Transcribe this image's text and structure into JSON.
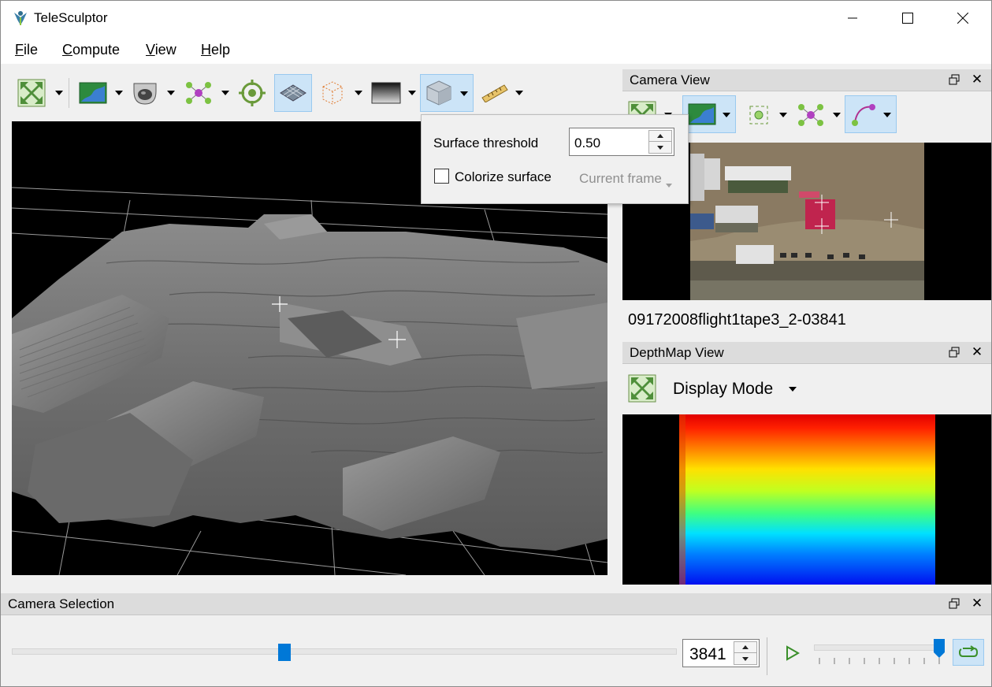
{
  "window": {
    "title": "TeleSculptor",
    "controls": {
      "minimize": "–",
      "maximize": "☐",
      "close": "✕"
    }
  },
  "menu": {
    "items": [
      "File",
      "Compute",
      "View",
      "Help"
    ]
  },
  "main_toolbar": {
    "buttons": [
      {
        "icon": "reset-view-icon",
        "dropdown": true
      },
      {
        "icon": "camera-image-icon",
        "dropdown": true
      },
      {
        "icon": "camera-frustum-icon",
        "dropdown": true
      },
      {
        "icon": "feature-points-icon",
        "dropdown": true
      },
      {
        "icon": "ground-control-target-icon",
        "dropdown": false
      },
      {
        "icon": "ground-plane-grid-icon",
        "dropdown": false,
        "active": true
      },
      {
        "icon": "region-of-interest-icon",
        "dropdown": true
      },
      {
        "icon": "depth-map-icon",
        "dropdown": true
      },
      {
        "icon": "surface-mesh-icon",
        "dropdown": true,
        "active": true
      },
      {
        "icon": "measuring-ruler-icon",
        "dropdown": true
      }
    ]
  },
  "surface_popup": {
    "threshold_label": "Surface threshold",
    "threshold_value": "0.50",
    "colorize_label": "Colorize surface",
    "colorize_checked": false,
    "frame_option": "Current frame"
  },
  "camera_view": {
    "title": "Camera View",
    "frame_name": "09172008flight1tape3_2-03841",
    "toolbar_icons": [
      "reset-view-icon",
      "camera-image-icon",
      "tracked-points-icon",
      "feature-points-icon",
      "residuals-icon"
    ]
  },
  "depth_view": {
    "title": "DepthMap View",
    "display_mode_label": "Display Mode"
  },
  "camera_selection": {
    "title": "Camera Selection",
    "frame_number": "3841",
    "frame_slider_position": 0.41,
    "speed_slider_position": 0.96
  },
  "colors": {
    "accent": "#0078d7",
    "active_button_bg": "#cce4f7",
    "dock_title_bg": "#dcdcdc"
  }
}
